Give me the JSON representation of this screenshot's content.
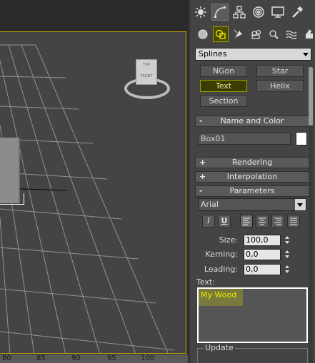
{
  "viewport": {
    "ruler_ticks": [
      "80",
      "85",
      "90",
      "95",
      "100"
    ],
    "viewcube_top_label": "TOP",
    "viewcube_front_label": "FRONT",
    "colors": {
      "active_border": "#c8a400",
      "grid": "#9a9a9a",
      "background": "#444444"
    }
  },
  "command_panel": {
    "tabs": [
      {
        "icon": "sun-icon",
        "active": false
      },
      {
        "icon": "modify-curve-icon",
        "active": true
      },
      {
        "icon": "hierarchy-icon",
        "active": false
      },
      {
        "icon": "motion-icon",
        "active": false
      },
      {
        "icon": "display-icon",
        "active": false
      },
      {
        "icon": "utilities-hammer-icon",
        "active": false
      }
    ],
    "subcategories": [
      {
        "icon": "geometry-sphere-icon",
        "active": false
      },
      {
        "icon": "shapes-icon",
        "active": true
      },
      {
        "icon": "lights-icon",
        "active": false
      },
      {
        "icon": "cameras-icon",
        "active": false
      },
      {
        "icon": "helpers-icon",
        "active": false
      },
      {
        "icon": "spacewarps-icon",
        "active": false
      },
      {
        "icon": "systems-icon",
        "active": false
      }
    ],
    "category": "Splines",
    "object_buttons": [
      {
        "label": "NGon",
        "active": false
      },
      {
        "label": "Star",
        "active": false
      },
      {
        "label": "Text",
        "active": true
      },
      {
        "label": "Helix",
        "active": false
      },
      {
        "label": "Section",
        "active": false
      }
    ],
    "name_and_color": {
      "header": "Name and Color",
      "sign": "-",
      "name_value": "Box01",
      "color": "#ffffff"
    },
    "rendering": {
      "header": "Rendering",
      "sign": "+"
    },
    "interpolation": {
      "header": "Interpolation",
      "sign": "+"
    },
    "parameters": {
      "header": "Parameters",
      "sign": "-",
      "font": "Arial",
      "italic_label": "I",
      "underline_label": "U",
      "size_label": "Size:",
      "size_value": "100,0",
      "kerning_label": "Kerning:",
      "kerning_value": "0,0",
      "leading_label": "Leading:",
      "leading_value": "0,0",
      "text_label": "Text:",
      "text_value": "My Wood",
      "update_label": "Update"
    }
  }
}
